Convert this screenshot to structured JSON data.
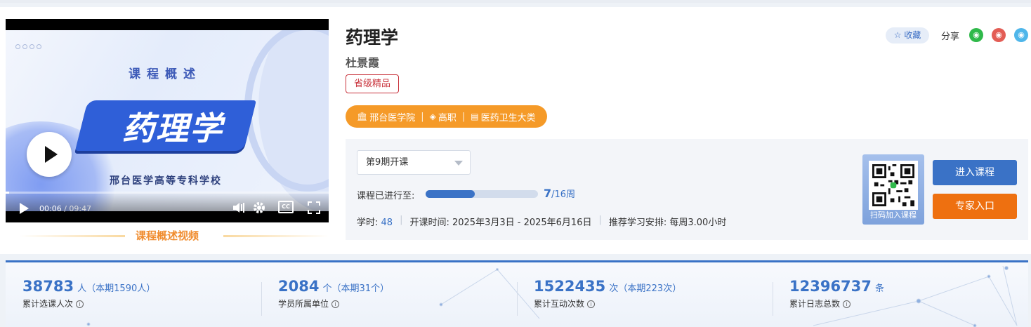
{
  "video": {
    "overview_text": "课程概述",
    "big_title": "药理学",
    "school_line": "邢台医学高等专科学校",
    "current_time": "00:06",
    "duration": "09:47",
    "progress": 0.01,
    "caption": "课程概述视频"
  },
  "course": {
    "title": "药理学",
    "teacher": "杜景霞",
    "badge": "省级精品",
    "tags": [
      "邢台医学院",
      "高职",
      "医药卫生大类"
    ]
  },
  "actions": {
    "favorite_label": "收藏",
    "share_label": "分享",
    "share_targets": [
      "wechat",
      "weibo",
      "qq"
    ]
  },
  "session": {
    "selected": "第9期开课",
    "progress_label": "课程已进行至:",
    "current_week": "7",
    "total_weeks": "/16周",
    "progress_fraction": 0.4375,
    "hours_label": "学时:",
    "hours_value": "48",
    "schedule": "开课时间: 2025年3月3日 - 2025年6月16日",
    "recommend": "推荐学习安排: 每周3.00小时"
  },
  "qr": {
    "label": "扫码加入课程"
  },
  "buttons": {
    "enter": "进入课程",
    "expert": "专家入口"
  },
  "stats": [
    {
      "num": "38783",
      "unit": "人（本期1590人）",
      "label": "累计选课人次"
    },
    {
      "num": "2084",
      "unit": "个（本期31个）",
      "label": "学员所属单位"
    },
    {
      "num": "1522435",
      "unit": "次（本期223次）",
      "label": "累计互动次数"
    },
    {
      "num": "12396737",
      "unit": "条",
      "label": "累计日志总数"
    }
  ],
  "colors": {
    "primary": "#3a72c6",
    "orange": "#f59a28",
    "expert": "#ee7010",
    "badge": "#c8313a"
  }
}
